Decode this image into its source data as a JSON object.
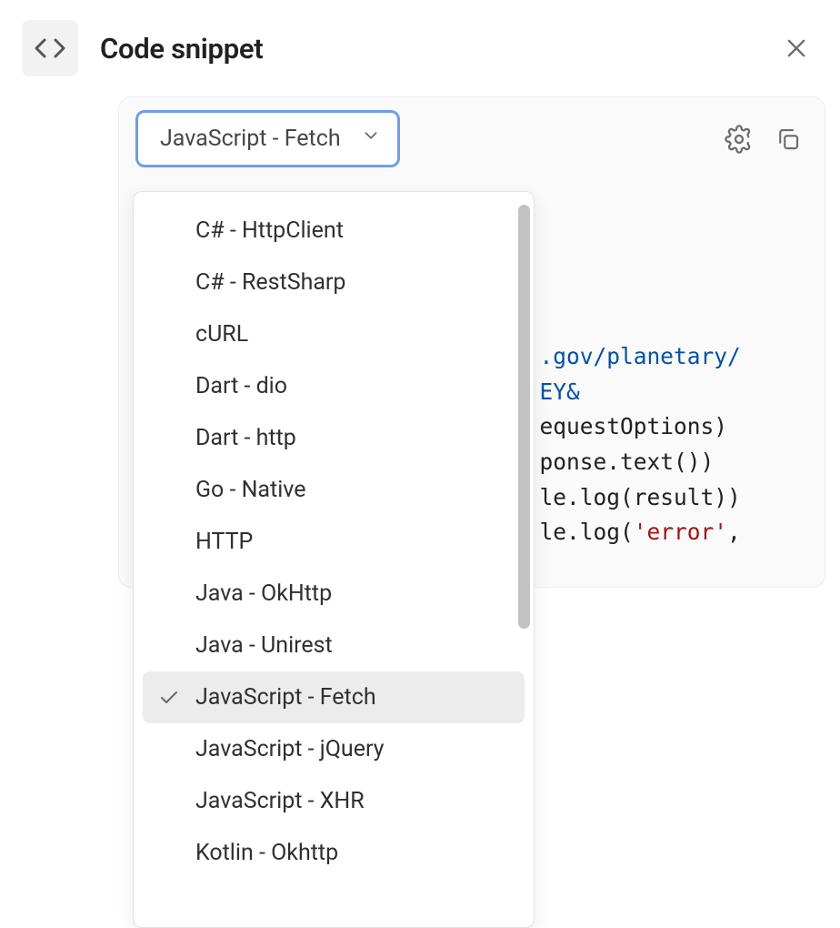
{
  "header": {
    "title": "Code snippet"
  },
  "toolbar": {
    "language_selected": "JavaScript - Fetch"
  },
  "code": {
    "url_fragment": ".gov/planetary/",
    "url_fragment2": "EY&",
    "line3_tail": "equestOptions)",
    "line4_tail": "ponse.text())",
    "line5_tail": "le.log(result))",
    "line6_prefix": "le.log(",
    "line6_str": "'error'",
    "line6_suffix": ","
  },
  "dropdown": {
    "selected": "JavaScript - Fetch",
    "options": [
      "C# - HttpClient",
      "C# - RestSharp",
      "cURL",
      "Dart - dio",
      "Dart - http",
      "Go - Native",
      "HTTP",
      "Java - OkHttp",
      "Java - Unirest",
      "JavaScript - Fetch",
      "JavaScript - jQuery",
      "JavaScript - XHR",
      "Kotlin - Okhttp"
    ]
  }
}
